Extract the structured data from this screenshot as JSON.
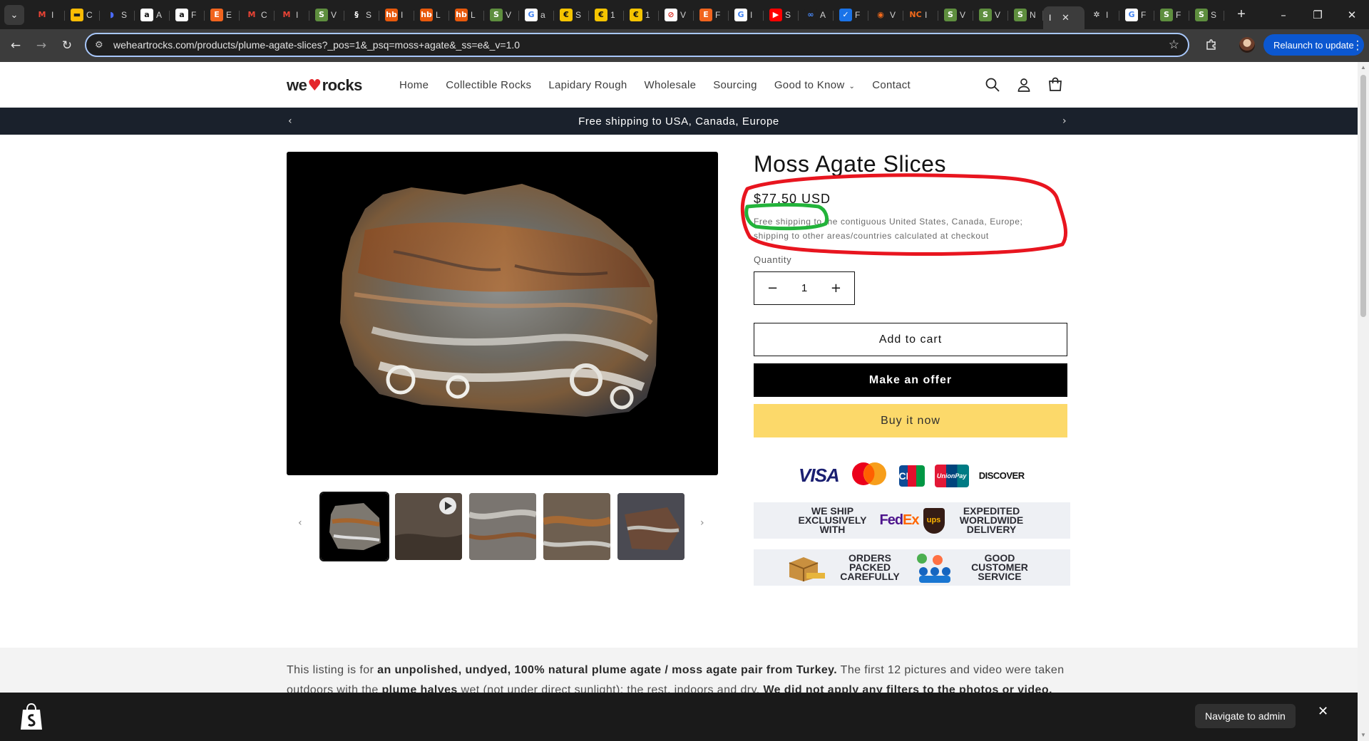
{
  "browser": {
    "tabs": [
      {
        "icon": "gmail-icon",
        "label": "I",
        "bg": "#1f1f1f",
        "fg": "#ea4335",
        "glyph": "M"
      },
      {
        "icon": "google-wallet-icon",
        "label": "C",
        "bg": "#fbbc04",
        "fg": "#1f1f1f",
        "glyph": "▬"
      },
      {
        "icon": "swirl-icon",
        "label": "S",
        "bg": "#1f1f1f",
        "fg": "#4b6bff",
        "glyph": "◗"
      },
      {
        "icon": "amazon-icon",
        "label": "A",
        "bg": "#ffffff",
        "fg": "#111",
        "glyph": "a"
      },
      {
        "icon": "amazon-icon",
        "label": "F",
        "bg": "#ffffff",
        "fg": "#111",
        "glyph": "a"
      },
      {
        "icon": "etsy-icon",
        "label": "E",
        "bg": "#f1641e",
        "fg": "#fff",
        "glyph": "E"
      },
      {
        "icon": "gmail-icon",
        "label": "C",
        "bg": "#1f1f1f",
        "fg": "#ea4335",
        "glyph": "M"
      },
      {
        "icon": "gmail-icon",
        "label": "I",
        "bg": "#1f1f1f",
        "fg": "#ea4335",
        "glyph": "M"
      },
      {
        "icon": "shopify-icon",
        "label": "V",
        "bg": "#5e8e3e",
        "fg": "#fff",
        "glyph": "S"
      },
      {
        "icon": "squarespace-icon",
        "label": "S",
        "bg": "#1f1f1f",
        "fg": "#fff",
        "glyph": "§"
      },
      {
        "icon": "hb-icon",
        "label": "I",
        "bg": "#e8590c",
        "fg": "#fff",
        "glyph": "hb"
      },
      {
        "icon": "hb-icon",
        "label": "L",
        "bg": "#e8590c",
        "fg": "#fff",
        "glyph": "hb"
      },
      {
        "icon": "hb-icon",
        "label": "L",
        "bg": "#e8590c",
        "fg": "#fff",
        "glyph": "hb"
      },
      {
        "icon": "shopify-icon",
        "label": "V",
        "bg": "#5e8e3e",
        "fg": "#fff",
        "glyph": "S"
      },
      {
        "icon": "google-icon",
        "label": "a",
        "bg": "#ffffff",
        "fg": "#4285f4",
        "glyph": "G"
      },
      {
        "icon": "coin-icon",
        "label": "S",
        "bg": "#f5c400",
        "fg": "#111",
        "glyph": "€"
      },
      {
        "icon": "coin-icon",
        "label": "1",
        "bg": "#f5c400",
        "fg": "#111",
        "glyph": "€"
      },
      {
        "icon": "coin-icon",
        "label": "1",
        "bg": "#f5c400",
        "fg": "#111",
        "glyph": "€"
      },
      {
        "icon": "blocked-icon",
        "label": "V",
        "bg": "#ffffff",
        "fg": "#d93025",
        "glyph": "⊘"
      },
      {
        "icon": "etsy-icon",
        "label": "F",
        "bg": "#f1641e",
        "fg": "#fff",
        "glyph": "E"
      },
      {
        "icon": "google-icon",
        "label": "I",
        "bg": "#ffffff",
        "fg": "#4285f4",
        "glyph": "G"
      },
      {
        "icon": "youtube-icon",
        "label": "S",
        "bg": "#ff0000",
        "fg": "#fff",
        "glyph": "▶"
      },
      {
        "icon": "meta-icon",
        "label": "A",
        "bg": "#1f1f1f",
        "fg": "#4a8cff",
        "glyph": "∞"
      },
      {
        "icon": "check-shield-icon",
        "label": "F",
        "bg": "#1a73e8",
        "fg": "#fff",
        "glyph": "✓"
      },
      {
        "icon": "orange-circle-icon",
        "label": "V",
        "bg": "#1f1f1f",
        "fg": "#f26a1b",
        "glyph": "◉"
      },
      {
        "icon": "nc-icon",
        "label": "I",
        "bg": "#1f1f1f",
        "fg": "#f26a1b",
        "glyph": "NC"
      },
      {
        "icon": "shopify-icon",
        "label": "V",
        "bg": "#5e8e3e",
        "fg": "#fff",
        "glyph": "S"
      },
      {
        "icon": "shopify-icon",
        "label": "V",
        "bg": "#5e8e3e",
        "fg": "#fff",
        "glyph": "S"
      },
      {
        "icon": "shopify-icon",
        "label": "N",
        "bg": "#5e8e3e",
        "fg": "#fff",
        "glyph": "S"
      }
    ],
    "tabs_after": [
      {
        "icon": "chatgpt-icon",
        "label": "I",
        "bg": "#1f1f1f",
        "fg": "#e3e3e3",
        "glyph": "✲"
      },
      {
        "icon": "google-icon",
        "label": "F",
        "bg": "#ffffff",
        "fg": "#4285f4",
        "glyph": "G"
      },
      {
        "icon": "shopify-icon",
        "label": "F",
        "bg": "#5e8e3e",
        "fg": "#fff",
        "glyph": "S"
      },
      {
        "icon": "shopify-icon",
        "label": "S",
        "bg": "#5e8e3e",
        "fg": "#fff",
        "glyph": "S"
      }
    ],
    "url": "weheartrocks.com/products/plume-agate-slices?_pos=1&_psq=moss+agate&_ss=e&_v=1.0",
    "relaunch_label": "Relaunch to update"
  },
  "site": {
    "logo_left": "we",
    "logo_heart": "♥",
    "logo_right": "rocks",
    "nav": [
      "Home",
      "Collectible Rocks",
      "Lapidary Rough",
      "Wholesale",
      "Sourcing",
      "Good to Know",
      "Contact"
    ],
    "announcement": "Free shipping to USA, Canada, Europe"
  },
  "product": {
    "title": "Moss Agate Slices",
    "price": "$77.50 USD",
    "shipping_note": "Free shipping to the contiguous United States, Canada, Europe; shipping to other areas/countries calculated at checkout",
    "quantity_label": "Quantity",
    "quantity_value": "1",
    "add_to_cart": "Add to cart",
    "make_offer": "Make an offer",
    "buy_now": "Buy it now",
    "payments": {
      "visa": "VISA",
      "jcb": "JCB",
      "unionpay": "UnionPay",
      "discover": "DISCOVER"
    },
    "banner1": {
      "left": "WE SHIP EXCLUSIVELY WITH",
      "fedex_fed": "Fed",
      "fedex_ex": "Ex",
      "ups": "ups",
      "right": "EXPEDITED WORLDWIDE DELIVERY"
    },
    "banner2": {
      "left": "ORDERS PACKED CAREFULLY",
      "right": "GOOD CUSTOMER SERVICE"
    }
  },
  "description": {
    "p1_a": "This listing is for ",
    "p1_b": "an unpolished, undyed, 100% natural plume agate / moss agate pair from Turkey.",
    "p1_c": " The first 12 pictures and video were taken outdoors with the ",
    "p1_d": "plume halves",
    "p1_e": " wet (not under direct sunlight); the rest, indoors and dry. ",
    "p1_f": "We did not apply any filters to the photos or video, before or after taking them."
  },
  "admin": {
    "navigate_label": "Navigate to admin"
  },
  "colors": {
    "annotation_red": "#e8151f",
    "annotation_green": "#22b33a",
    "buy_now_bg": "#fcd96a",
    "announcement_bg": "#1a212c"
  }
}
